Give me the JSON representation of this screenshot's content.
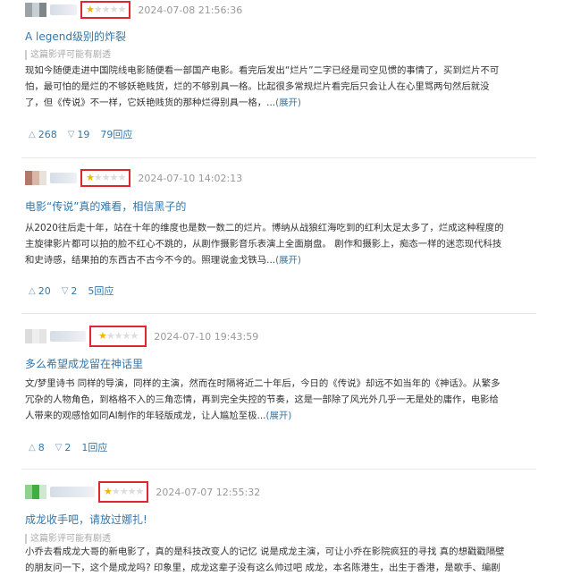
{
  "reviews": [
    {
      "avatar_colors": [
        "#9aa3a8",
        "#c8cfd3",
        "#7d868b"
      ],
      "rating": 1,
      "time": "2024-07-08 21:56:36",
      "title": "A legend级别的炸裂",
      "spoiler": "这篇影评可能有剧透",
      "lines": [
        "现如今随便走进中国院线电影随便看一部国产电影。看完后发出“烂片”二字已经是司空见惯的事情了，买到烂片不可",
        "怕，最可怕的是烂的不够妖艳贱货，烂的不够别具一格。比起很多常规烂片看完后只会让人在心里骂两句然后就没",
        "了，但《传说》不一样，它妖艳贱货的那种烂得别具一格，..."
      ],
      "expand": "(展开)",
      "useful": "268",
      "useless": "19",
      "replies": "79回应"
    },
    {
      "avatar_colors": [
        "#b07a6a",
        "#d9b7a8",
        "#e8e2dc"
      ],
      "rating": 1,
      "time": "2024-07-10 14:02:13",
      "title": "电影“传说”真的难看，相信黑子的",
      "spoiler": "",
      "lines": [
        "从2020往后走十年，站在十年的维度也是数一数二的烂片。博纳从战狼红海吃到的红利太足太多了，烂成这种程度的",
        "主旋律影片都可以拍的脸不红心不跳的，从剧作摄影音乐表演上全面崩盘。 剧作和摄影上，痴态一样的迷恋现代科技",
        "和史诗感，结果拍的东西古不古今不今的。照理说金戈铁马..."
      ],
      "expand": "(展开)",
      "useful": "20",
      "useless": "2",
      "replies": "5回应"
    },
    {
      "avatar_colors": [
        "#dcdcdc",
        "#eeeeee",
        "#e4e4e4"
      ],
      "rating": 1,
      "time": "2024-07-10 19:43:59",
      "title": "多么希望成龙留在神话里",
      "spoiler": "",
      "lines": [
        "文/梦里诗书 同样的导演，同样的主演，然而在时隔将近二十年后，今日的《传说》却远不如当年的《神话》。从繁多",
        "冗杂的人物角色，到格格不入的三角恋情，再到完全失控的节奏，这是一部除了风光外几乎一无是处的庸作，电影给",
        "人带来的观感恰如同AI制作的年轻版成龙，让人尴尬至极..."
      ],
      "expand": "(展开)",
      "useful": "8",
      "useless": "2",
      "replies": "1回应"
    },
    {
      "avatar_colors": [
        "#8fd18f",
        "#3fb03f",
        "#cfe9cf"
      ],
      "rating": 1,
      "time": "2024-07-07 12:55:32",
      "title": "成龙收手吧，请放过娜扎!",
      "spoiler": "这篇影评可能有剧透",
      "lines": [
        "小乔去看成龙大哥的新电影了，真的是科技改变人的记忆 说是成龙主演，可让小乔在影院疯狂的寻找 真的想戳戳隔壁",
        "的朋友问一下，这个是成龙吗? 印象里，成龙这辈子没有这么帅过吧 成龙，本名陈港生，出生于香港，是歌手、编剧"
      ],
      "expand": "",
      "useful": "",
      "useless": "",
      "replies": ""
    }
  ],
  "icons": {
    "up": "triangle-up-outline",
    "down": "triangle-down-outline"
  },
  "colors": {
    "highlight_box": "#e0262f",
    "link": "#3377aa",
    "star_on": "#f4b400",
    "star_off": "#dddddd"
  }
}
